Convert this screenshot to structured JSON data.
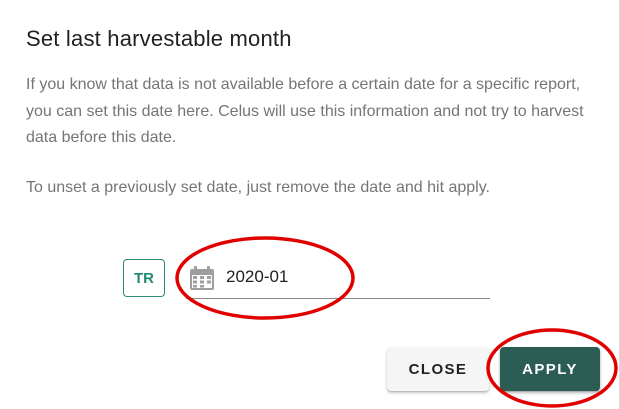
{
  "dialog": {
    "title": "Set last harvestable month",
    "description": "If you know that data is not available before a certain date for a specific report, you can set this date here. Celus will use this information and not try to harvest data before this date.",
    "hint": "To unset a previously set date, just remove the date and hit apply."
  },
  "report": {
    "code": "TR"
  },
  "date_field": {
    "value": "2020-01",
    "icon": "calendar-icon"
  },
  "buttons": {
    "close_label": "CLOSE",
    "apply_label": "APPLY"
  },
  "colors": {
    "accent": "#2b5d54",
    "badge": "#1f8a74",
    "annotation": "#e00000"
  }
}
